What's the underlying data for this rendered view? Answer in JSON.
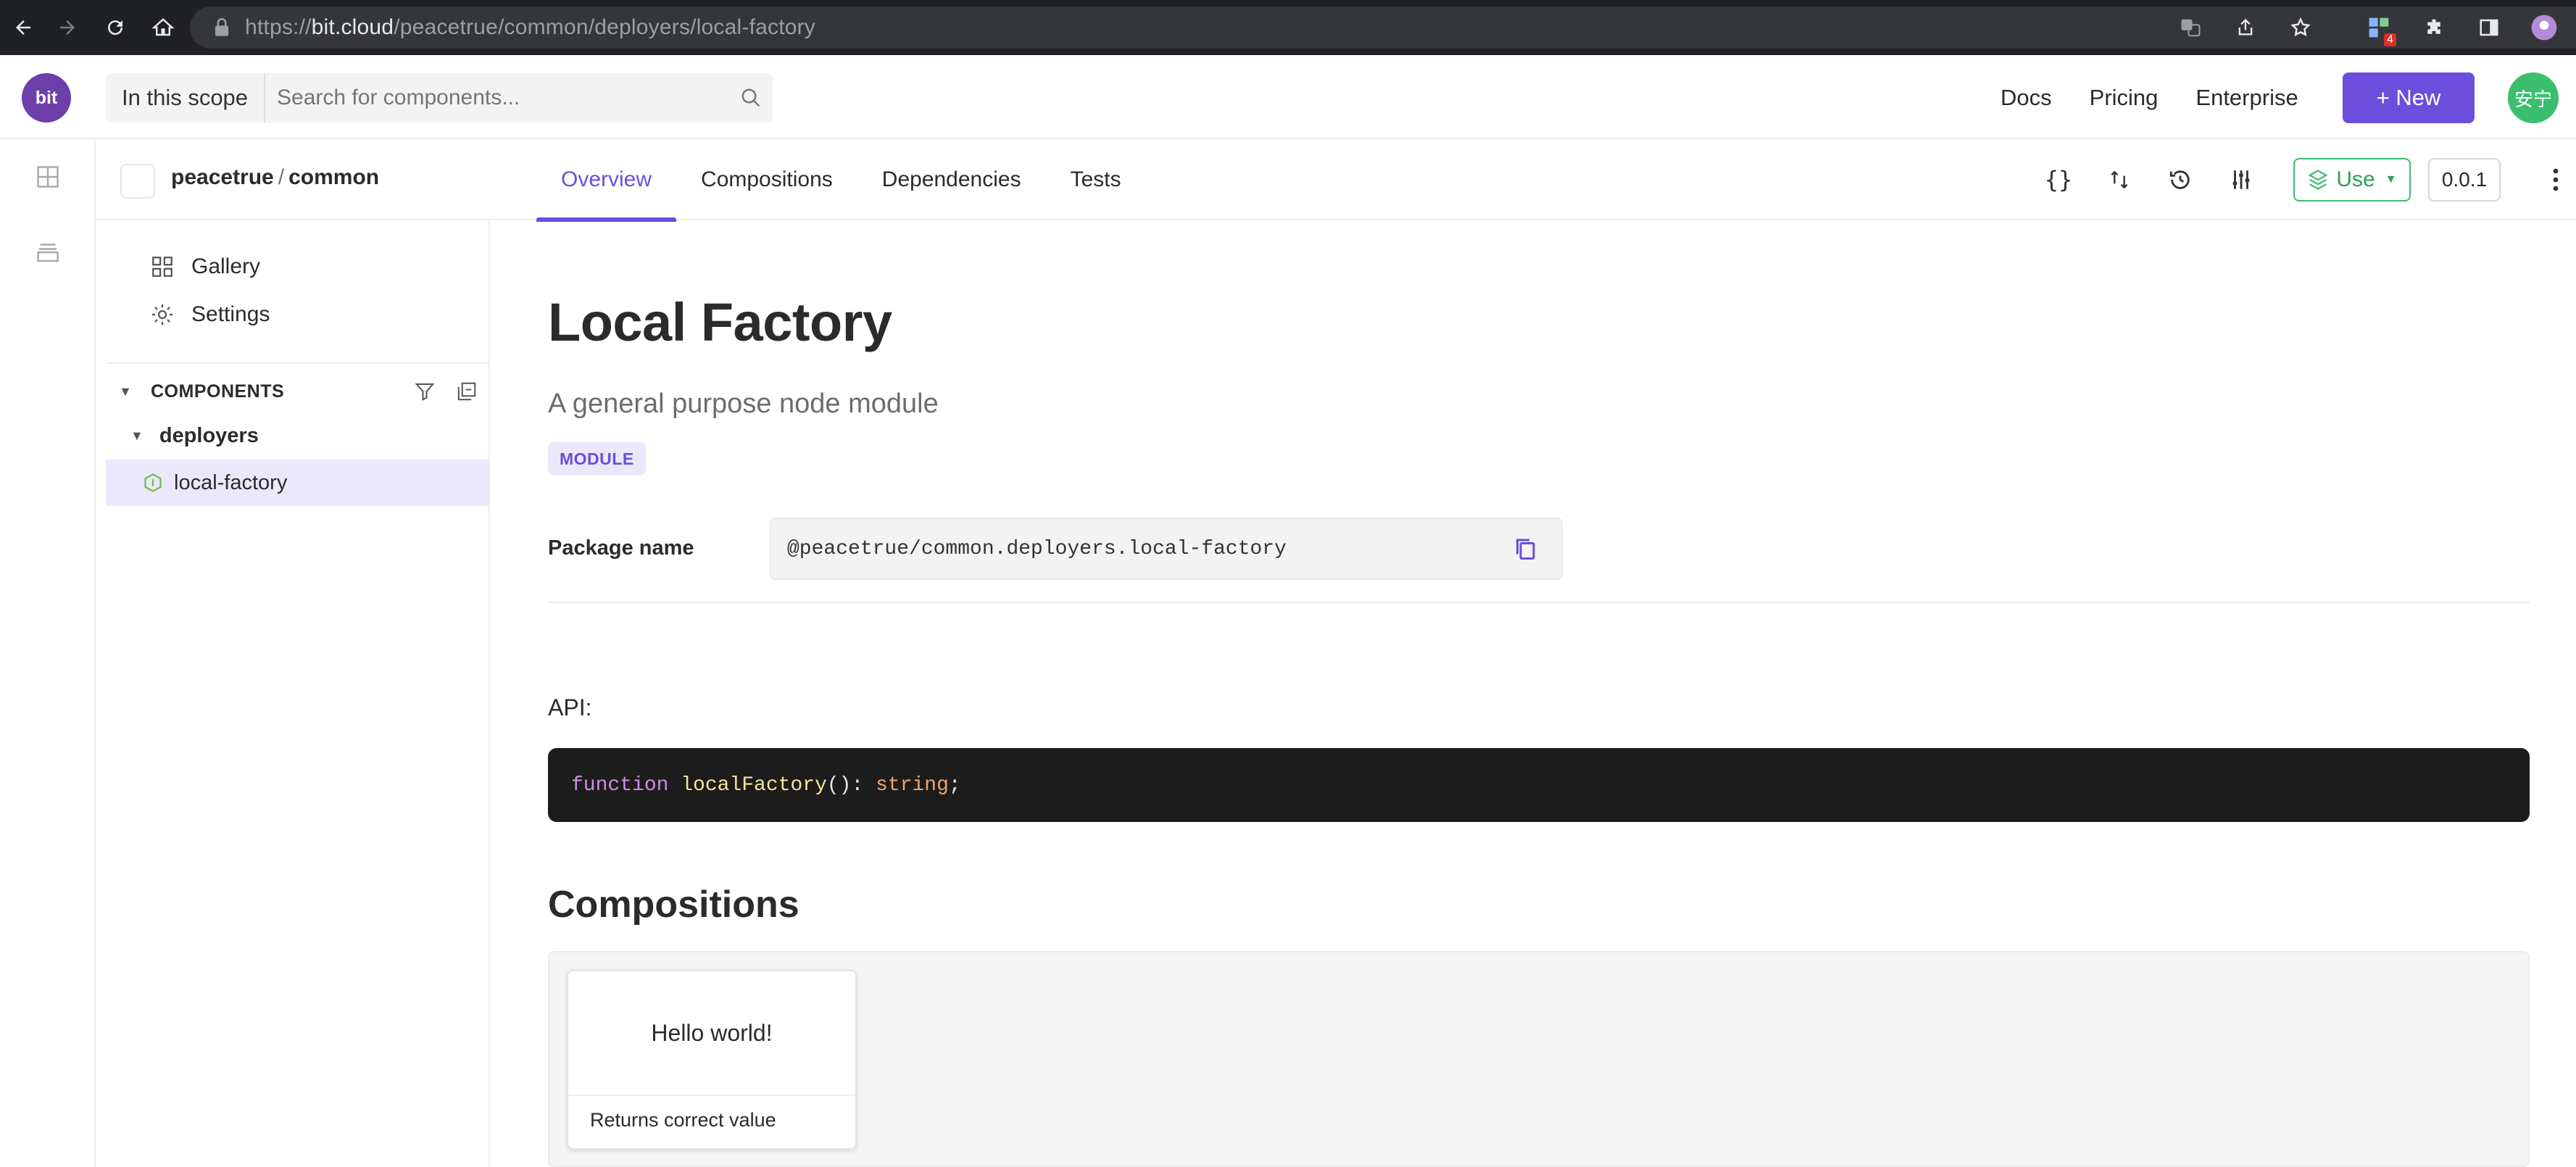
{
  "browser": {
    "url_prefix": "https://",
    "url_domain": "bit.cloud",
    "url_path": "/peacetrue/common/deployers/local-factory",
    "ext_badge": "4"
  },
  "header": {
    "logo_text": "bit",
    "scope_label": "In this scope",
    "search_placeholder": "Search for components...",
    "links": [
      "Docs",
      "Pricing",
      "Enterprise"
    ],
    "new_button": "+ New",
    "avatar_text": "安宁"
  },
  "subheader": {
    "owner": "peacetrue",
    "separator": "/",
    "scope": "common",
    "tabs": [
      "Overview",
      "Compositions",
      "Dependencies",
      "Tests"
    ],
    "active_tab": "Overview",
    "use_label": "Use",
    "version": "0.0.1"
  },
  "sidebar": {
    "items": [
      "Gallery",
      "Settings"
    ],
    "components_header": "COMPONENTS",
    "folder": "deployers",
    "component": "local-factory"
  },
  "main": {
    "title": "Local Factory",
    "description": "A general purpose node module",
    "badge": "MODULE",
    "package_label": "Package name",
    "package_name": "@peacetrue/common.deployers.local-factory",
    "api_label": "API:",
    "code": {
      "keyword": "function",
      "name": "localFactory",
      "punct": "(): ",
      "type": "string",
      "end": ";"
    },
    "compositions_title": "Compositions",
    "composition": {
      "preview": "Hello world!",
      "caption": "Returns correct value"
    }
  },
  "colors": {
    "accent": "#6b4edc",
    "use_green": "#3bbf6f",
    "code_bg": "#1c1c1c"
  }
}
